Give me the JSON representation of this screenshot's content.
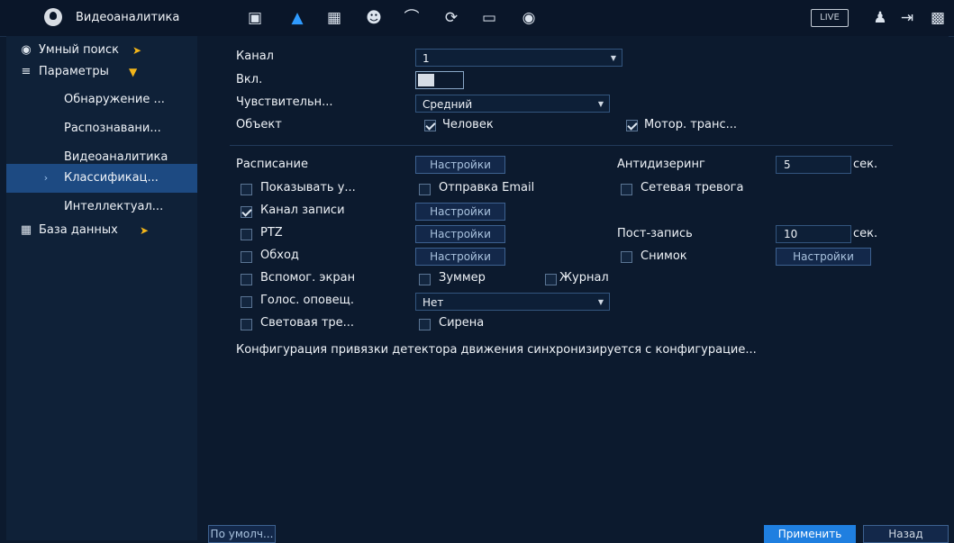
{
  "header": {
    "title": "Видеоаналитика",
    "live_label": "LIVE",
    "icons": [
      "camera-icon",
      "alarm-icon",
      "storage-icon",
      "face-icon",
      "network-icon",
      "sync-icon",
      "display-icon",
      "audio-icon",
      "user-icon",
      "logout-icon",
      "qr-icon"
    ]
  },
  "sidebar": {
    "items": [
      {
        "label": "Умный поиск"
      },
      {
        "label": "Параметры"
      },
      {
        "label": "Обнаружение ..."
      },
      {
        "label": "Распознавани..."
      },
      {
        "label": "Видеоаналитика"
      },
      {
        "label": "Классификац..."
      },
      {
        "label": "Интеллектуал..."
      },
      {
        "label": "База данных"
      }
    ]
  },
  "form": {
    "channel_label": "Канал",
    "channel_value": "1",
    "enable_label": "Вкл.",
    "sensitivity_label": "Чувствительн...",
    "sensitivity_value": "Средний",
    "object_label": "Объект",
    "object_person": "Человек",
    "object_vehicle": "Мотор. транс...",
    "schedule_label": "Расписание",
    "settings_label": "Настройки",
    "antidither_label": "Антидизеринг",
    "antidither_value": "5",
    "sec_label": "сек.",
    "show_label": "Показывать у...",
    "email_label": "Отправка Email",
    "net_alarm_label": "Сетевая тревога",
    "record_label": "Канал записи",
    "ptz_label": "PTZ",
    "post_record_label": "Пост-запись",
    "post_record_value": "10",
    "tour_label": "Обход",
    "snapshot_label": "Снимок",
    "aux_screen_label": "Вспомог. экран",
    "buzzer_label": "Зуммер",
    "log_label": "Журнал",
    "voice_label": "Голос. оповещ.",
    "voice_value": "Нет",
    "light_label": "Световая тре...",
    "siren_label": "Сирена",
    "note": "Конфигурация привязки детектора движения синхронизируется с конфигурацие..."
  },
  "footer": {
    "default_label": "По умолч...",
    "apply_label": "Применить",
    "back_label": "Назад"
  },
  "colors": {
    "accent": "#1f7fe0",
    "selected": "#1d4a82",
    "arrow": "#f2b51a"
  }
}
